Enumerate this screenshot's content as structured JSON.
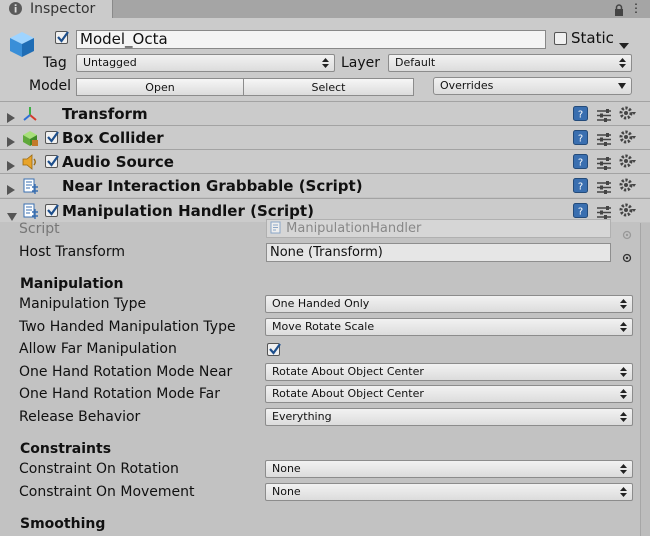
{
  "window": {
    "tab_title": "Inspector"
  },
  "object": {
    "active": true,
    "name": "Model_Octa",
    "static_label": "Static",
    "static_checked": false,
    "tag_label": "Tag",
    "tag_value": "Untagged",
    "layer_label": "Layer",
    "layer_value": "Default",
    "model_label": "Model",
    "open_label": "Open",
    "select_label": "Select",
    "overrides_label": "Overrides"
  },
  "components": [
    {
      "title": "Transform",
      "has_checkbox": false,
      "icon": "transform-icon"
    },
    {
      "title": "Box Collider",
      "has_checkbox": true,
      "icon": "box-collider-icon"
    },
    {
      "title": "Audio Source",
      "has_checkbox": true,
      "icon": "audio-source-icon"
    },
    {
      "title": "Near Interaction Grabbable (Script)",
      "has_checkbox": false,
      "icon": "script-icon"
    },
    {
      "title": "Manipulation Handler (Script)",
      "has_checkbox": true,
      "icon": "script-icon",
      "expanded": true
    }
  ],
  "handler": {
    "script_label": "Script",
    "script_value": "ManipulationHandler",
    "host_label": "Host Transform",
    "host_value": "None (Transform)",
    "sections": {
      "manipulation": "Manipulation",
      "constraints": "Constraints",
      "smoothing": "Smoothing"
    },
    "props": {
      "manip_type_label": "Manipulation Type",
      "manip_type_value": "One Handed Only",
      "two_handed_label": "Two Handed Manipulation Type",
      "two_handed_value": "Move Rotate Scale",
      "allow_far_label": "Allow Far Manipulation",
      "allow_far_checked": true,
      "rot_near_label": "One Hand Rotation Mode Near",
      "rot_near_value": "Rotate About Object Center",
      "rot_far_label": "One Hand Rotation Mode Far",
      "rot_far_value": "Rotate About Object Center",
      "release_label": "Release Behavior",
      "release_value": "Everything",
      "constraint_rot_label": "Constraint On Rotation",
      "constraint_rot_value": "None",
      "constraint_move_label": "Constraint On Movement",
      "constraint_move_value": "None"
    }
  },
  "colors": {
    "check_blue": "#1e4f8c",
    "help_blue": "#3a6fb0"
  }
}
